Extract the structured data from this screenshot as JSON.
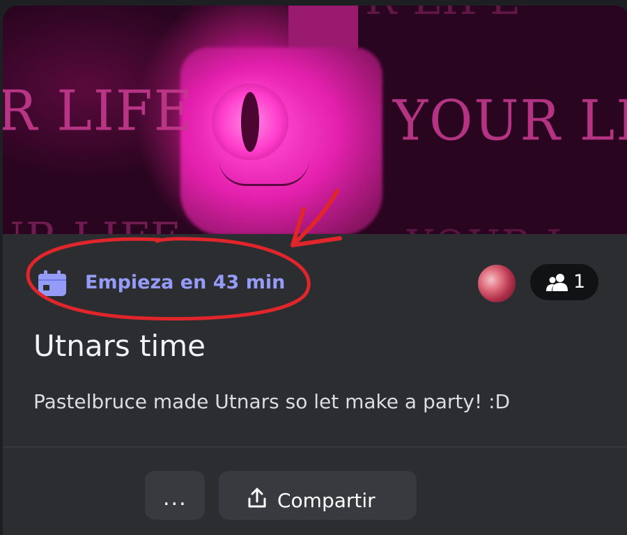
{
  "banner": {
    "text_left": "R LIFE",
    "text_right": "YOUR LIFE",
    "text_faint_top": "R LIFE",
    "text_faint_bottom": "UR LIFE",
    "text_faint_bottom2": "YOUR L"
  },
  "schedule": {
    "icon": "calendar-icon",
    "status_text": "Empieza en 43 min",
    "accent_color": "#949cf7"
  },
  "interested": {
    "icon": "people-icon",
    "count": "1"
  },
  "event": {
    "title": "Utnars time",
    "description": "Pastelbruce made Utnars so let make a party! :D"
  },
  "actions": {
    "more_label": "...",
    "share_icon": "share-icon",
    "share_label": "Compartir"
  },
  "annotation": {
    "color": "#e0252b",
    "shapes": [
      "circle-highlight",
      "arrow"
    ]
  }
}
